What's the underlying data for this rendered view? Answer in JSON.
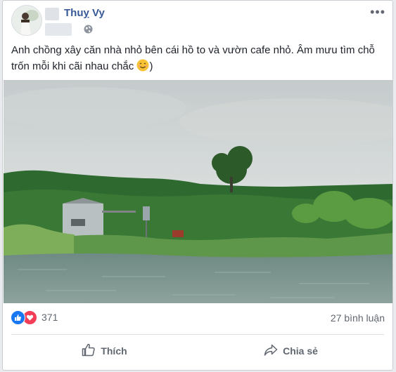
{
  "post": {
    "author": "Thuỵ Vy",
    "text": "Anh chồng xây căn nhà nhỏ bên cái hồ to và vườn cafe nhỏ. Âm mưu tìm chỗ trốn mỗi khi cãi nhau chắc",
    "text_tail": ")",
    "emoji": "smiling-face",
    "privacy_icon": "globe-icon",
    "menu_icon": "more-options-icon",
    "more_glyph": "•••"
  },
  "stats": {
    "reaction_icons": [
      "like-icon",
      "love-icon"
    ],
    "reaction_count": "371",
    "comments": "27 bình luận"
  },
  "actions": {
    "like_label": "Thích",
    "share_label": "Chia sẻ"
  },
  "colors": {
    "author_link": "#385898",
    "like_blue": "#1877f2",
    "love_red": "#f33e58",
    "secondary_text": "#606770"
  }
}
